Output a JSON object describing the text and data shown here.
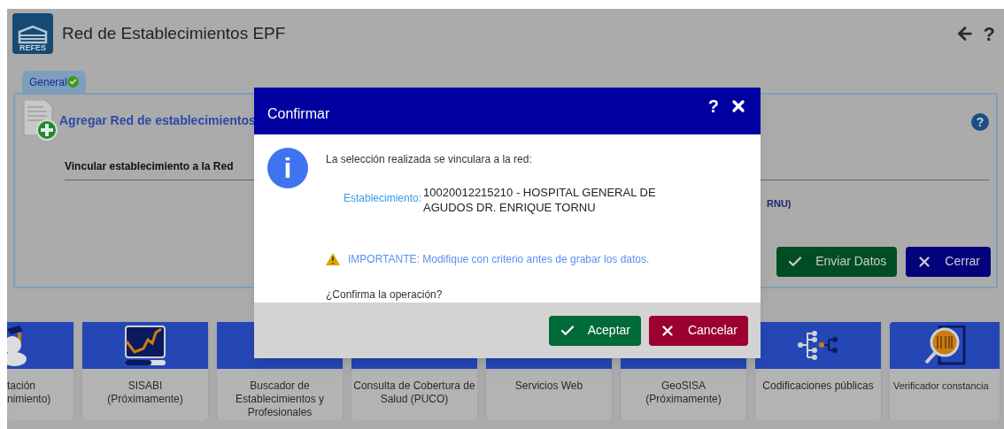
{
  "header": {
    "logo_text": "REFES",
    "title": "Red de Establecimientos EPF",
    "help_glyph": "?"
  },
  "tabs": [
    {
      "label": "General",
      "selected": true,
      "validated": true
    }
  ],
  "panel": {
    "title": "Agregar Red de establecimientos",
    "help_glyph": "?",
    "field_label": "Vincular establecimiento a la Red",
    "field_value": "RNU)",
    "buttons": [
      {
        "label": "Enviar Datos",
        "kind": "submit"
      },
      {
        "label": "Cerrar",
        "kind": "close"
      }
    ]
  },
  "tiles": [
    {
      "label": "tación\nnimiento)",
      "kind": "graduate"
    },
    {
      "label": "SISABI\n(Próximamente)",
      "kind": "monitor"
    },
    {
      "label": "Buscador de\nEstablecimientos y\nProfesionales",
      "kind": "hidden"
    },
    {
      "label": "Consulta de Cobertura de\nSalud (PUCO)",
      "kind": "hidden"
    },
    {
      "label": "Servicios Web",
      "kind": "hidden"
    },
    {
      "label": "GeoSISA\n(Próximamente)",
      "kind": "hidden"
    },
    {
      "label": "Codificaciones públicas",
      "kind": "tree"
    },
    {
      "label": "Verificador constancia",
      "kind": "barcode"
    }
  ],
  "dialog": {
    "title": "Confirmar",
    "help_glyph": "?",
    "info_glyph": "i",
    "message": "La selección realizada se vinculara a la red:",
    "field_label": "Establecimiento:",
    "field_value": "10020012215210 - HOSPITAL GENERAL DE AGUDOS DR. ENRIQUE TORNU",
    "warning": "IMPORTANTE: Modifique con criterio antes de grabar los datos.",
    "question": "¿Confirma la operación?",
    "buttons": [
      {
        "label": "Aceptar",
        "kind": "accept"
      },
      {
        "label": "Cancelar",
        "kind": "cancel"
      }
    ]
  }
}
